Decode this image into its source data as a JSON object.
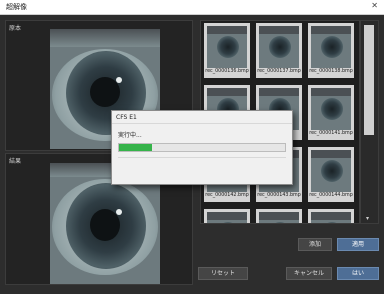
{
  "window": {
    "title": "超解像",
    "close_glyph": "✕"
  },
  "panels": {
    "source_label": "原本",
    "result_label": "結果"
  },
  "thumbnails": [
    {
      "name": "rec_0000136.bmp"
    },
    {
      "name": "rec_0000137.bmp"
    },
    {
      "name": "rec_0000138.bmp"
    },
    {
      "name": ""
    },
    {
      "name": ""
    },
    {
      "name": "rec_0000141.bmp"
    },
    {
      "name": "rec_0000142.bmp"
    },
    {
      "name": "rec_0000143.bmp"
    },
    {
      "name": "rec_0000144.bmp"
    },
    {
      "name": ""
    },
    {
      "name": ""
    },
    {
      "name": ""
    }
  ],
  "buttons": {
    "add": "添加",
    "apply": "適用",
    "reset": "リセット",
    "cancel": "キャンセル",
    "ok": "はい"
  },
  "dialog": {
    "title": "CFS E1",
    "message": "実行中...",
    "progress": 0.2
  },
  "colors": {
    "progress": "#35b34a",
    "primary_button": "#4e6e96"
  }
}
